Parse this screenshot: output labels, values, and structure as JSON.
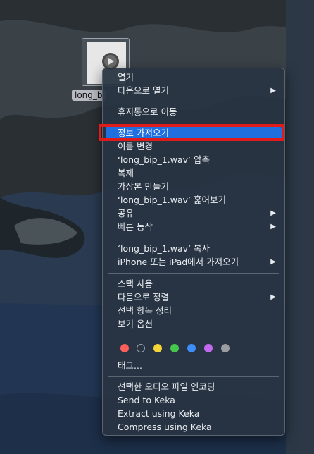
{
  "file": {
    "label": "long_b"
  },
  "menu": {
    "items": [
      {
        "label": "열기",
        "submenu": false
      },
      {
        "label": "다음으로 열기",
        "submenu": true
      },
      {
        "label": "휴지통으로 이동",
        "submenu": false
      },
      {
        "label": "정보 가져오기",
        "submenu": false,
        "highlighted": true
      },
      {
        "label": "이름 변경",
        "submenu": false
      },
      {
        "label": "‘long_bip_1.wav’ 압축",
        "submenu": false
      },
      {
        "label": "복제",
        "submenu": false
      },
      {
        "label": "가상본 만들기",
        "submenu": false
      },
      {
        "label": "‘long_bip_1.wav’ 훑어보기",
        "submenu": false
      },
      {
        "label": "공유",
        "submenu": true
      },
      {
        "label": "빠른 동작",
        "submenu": true
      },
      {
        "label": "‘long_bip_1.wav’ 복사",
        "submenu": false
      },
      {
        "label": "iPhone 또는 iPad에서 가져오기",
        "submenu": true
      },
      {
        "label": "스택 사용",
        "submenu": false
      },
      {
        "label": "다음으로 정렬",
        "submenu": true
      },
      {
        "label": "선택 항목 정리",
        "submenu": false
      },
      {
        "label": "보기 옵션",
        "submenu": false
      },
      {
        "label": "태그...",
        "submenu": false
      },
      {
        "label": "선택한 오디오 파일 인코딩",
        "submenu": false
      },
      {
        "label": "Send to Keka",
        "submenu": false
      },
      {
        "label": "Extract using Keka",
        "submenu": false
      },
      {
        "label": "Compress using Keka",
        "submenu": false
      }
    ],
    "submenu_arrow": "▶",
    "tag_colors": [
      "#ff5f5a",
      "none",
      "#f6d53b",
      "#47c64d",
      "#3d8ef7",
      "#c369f0",
      "#9b9da1"
    ]
  }
}
